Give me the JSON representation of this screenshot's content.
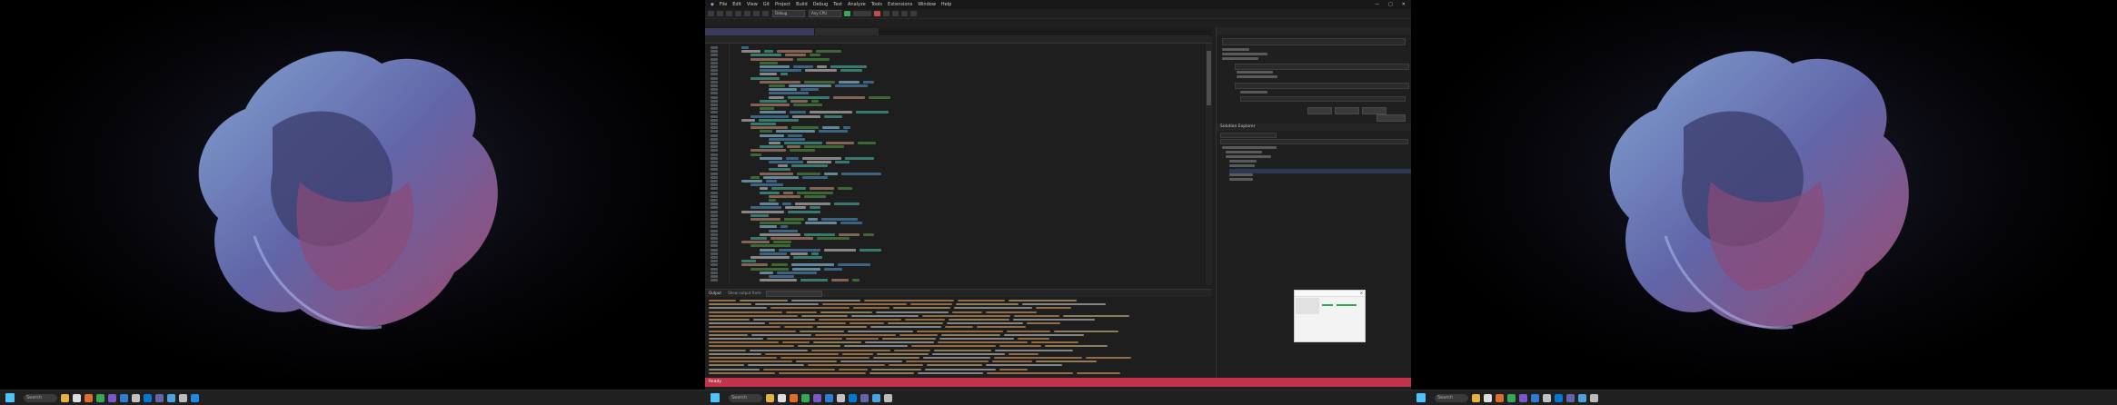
{
  "left_monitor": {
    "taskbar": {
      "search_label": "Search",
      "clock_time": "",
      "clock_date": ""
    }
  },
  "ide": {
    "title": "",
    "menu": [
      "File",
      "Edit",
      "View",
      "Git",
      "Project",
      "Build",
      "Debug",
      "Test",
      "Analyze",
      "Tools",
      "Extensions",
      "Window",
      "Help"
    ],
    "toolbar": {
      "config_combo": "Debug",
      "platform_combo": "Any CPU"
    },
    "tabs": [
      "",
      ""
    ],
    "nav_left": "",
    "nav_mid": "",
    "output_title": "Output",
    "output_source_label": "Show output from:",
    "status_text": "Ready",
    "status_right": ""
  },
  "right_panel": {
    "top_title": "",
    "bottom_title": "Solution Explorer"
  },
  "right_monitor": {
    "taskbar": {
      "search_label": "Search"
    },
    "popup_title": ""
  },
  "colors": {
    "accent": "#4cc2ff",
    "status_bar": "#c0334a",
    "keyword": "#569cd6",
    "string": "#d69d85",
    "comment": "#57a64a",
    "type": "#4ec9b0"
  }
}
